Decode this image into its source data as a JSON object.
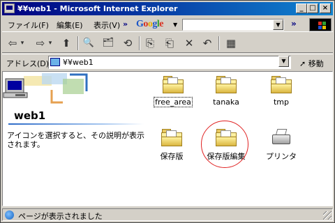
{
  "window": {
    "title": "¥¥web1 - Microsoft Internet Explorer",
    "minimize": "_",
    "maximize": "□",
    "close": "×"
  },
  "menu": {
    "items": [
      {
        "label": "ファイル(F)"
      },
      {
        "label": "編集(E)"
      },
      {
        "label": "表示(V)"
      }
    ],
    "overflow": "»",
    "google_logo": "Google",
    "google_dropdown": "▼",
    "search_dropdown": "▼",
    "toolbar_overflow": "»"
  },
  "toolbar": {
    "icons": [
      {
        "name": "back-icon",
        "glyph": "⇦"
      },
      {
        "name": "back-dropdown-icon",
        "glyph": "▾"
      },
      {
        "name": "forward-icon",
        "glyph": "⇨"
      },
      {
        "name": "forward-dropdown-icon",
        "glyph": "▾"
      },
      {
        "name": "up-folder-icon",
        "glyph": "⬆"
      },
      {
        "name": "search-icon",
        "glyph": "🔍"
      },
      {
        "name": "folders-icon",
        "glyph": "🗂"
      },
      {
        "name": "history-icon",
        "glyph": "⟲"
      },
      {
        "name": "move-to-icon",
        "glyph": "⎘"
      },
      {
        "name": "copy-to-icon",
        "glyph": "⎗"
      },
      {
        "name": "delete-icon",
        "glyph": "✕"
      },
      {
        "name": "undo-icon",
        "glyph": "↶"
      },
      {
        "name": "views-icon",
        "glyph": "▦"
      }
    ]
  },
  "address": {
    "label": "アドレス(D)",
    "value": "¥¥web1",
    "dropdown": "▼",
    "go_label": "移動",
    "go_icon": "➚"
  },
  "sidebar": {
    "folder_name": "web1",
    "description": "アイコンを選択すると、その説明が表示されます。"
  },
  "items": [
    {
      "label": "free_area",
      "type": "folder",
      "focused": true
    },
    {
      "label": "tanaka",
      "type": "folder"
    },
    {
      "label": "tmp",
      "type": "folder"
    },
    {
      "label": "保存版",
      "type": "folder"
    },
    {
      "label": "保存版編集",
      "type": "folder",
      "highlighted": true
    },
    {
      "label": "プリンタ",
      "type": "printer"
    }
  ],
  "status": {
    "text": "ページが表示されました"
  },
  "colors": {
    "title_start": "#000080",
    "title_end": "#1084d0",
    "highlight_circle": "#e02020",
    "face": "#d4d0c8"
  }
}
